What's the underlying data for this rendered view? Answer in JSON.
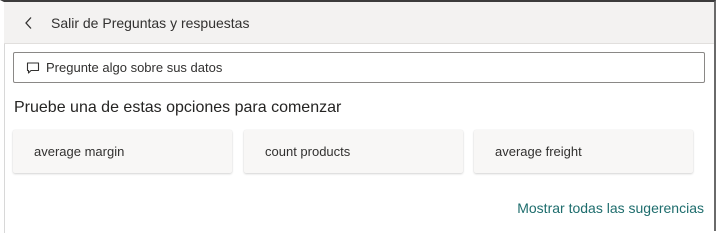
{
  "header": {
    "back_label": "Salir de Preguntas y respuestas"
  },
  "ask": {
    "placeholder": "Pregunte algo sobre sus datos",
    "value": ""
  },
  "suggestions": {
    "title": "Pruebe una de estas opciones para comenzar",
    "items": [
      {
        "label": "average margin"
      },
      {
        "label": "count products"
      },
      {
        "label": "average freight"
      }
    ],
    "show_all_label": "Mostrar todas las sugerencias"
  },
  "colors": {
    "header_bg": "#f3f2f1",
    "card_bg": "#f8f7f6",
    "link": "#1e6d6d",
    "text": "#323130"
  },
  "icons": {
    "back": "chevron-left-icon",
    "ask": "speech-bubble-icon"
  }
}
